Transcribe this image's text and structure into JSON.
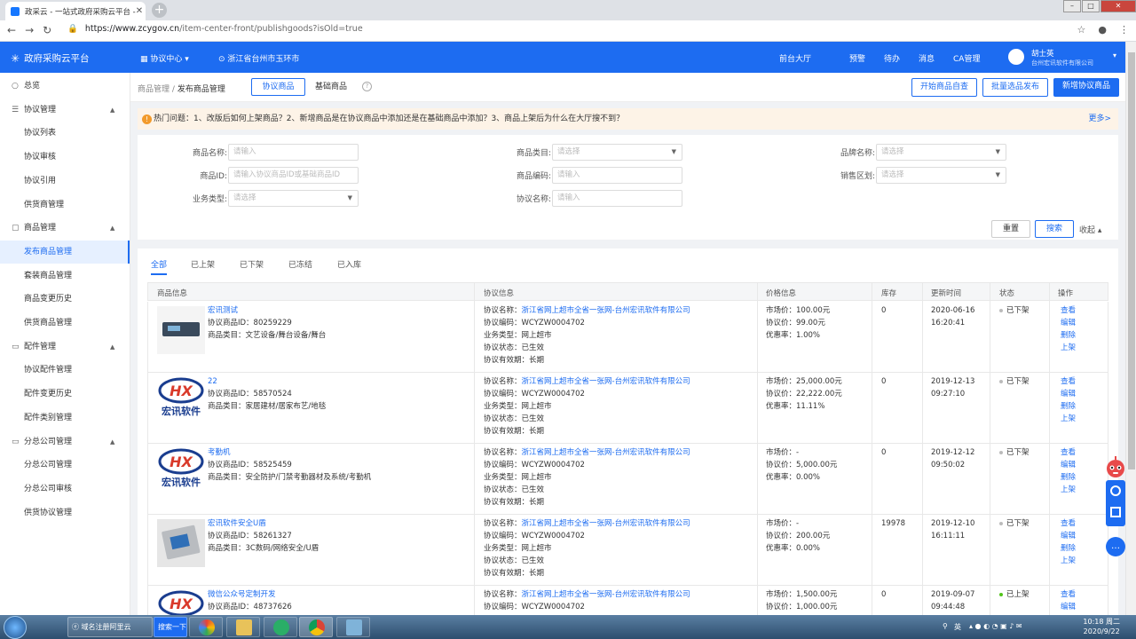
{
  "browser": {
    "tab_title": "政采云 - 一站式政府采购云平台 -",
    "url_main": "https://www.zcygov.cn",
    "url_path": "/item-center-front/publishgoods?isOld=true"
  },
  "header": {
    "logo": "政府采购云平台",
    "protocol_center": "协议中心",
    "location": "浙江省台州市玉环市",
    "nav": [
      "前台大厅",
      "预警",
      "待办",
      "消息",
      "CA管理"
    ],
    "user_name": "胡士英",
    "user_company": "台州宏讯软件有限公司"
  },
  "sidebar": {
    "items": [
      {
        "label": "总览",
        "type": "top"
      },
      {
        "label": "协议管理",
        "type": "group"
      },
      {
        "label": "协议列表",
        "type": "sub"
      },
      {
        "label": "协议审核",
        "type": "sub"
      },
      {
        "label": "协议引用",
        "type": "sub"
      },
      {
        "label": "供货商管理",
        "type": "sub"
      },
      {
        "label": "商品管理",
        "type": "group"
      },
      {
        "label": "发布商品管理",
        "type": "sub",
        "active": true
      },
      {
        "label": "套装商品管理",
        "type": "sub"
      },
      {
        "label": "商品变更历史",
        "type": "sub"
      },
      {
        "label": "供货商品管理",
        "type": "sub"
      },
      {
        "label": "配件管理",
        "type": "group"
      },
      {
        "label": "协议配件管理",
        "type": "sub"
      },
      {
        "label": "配件变更历史",
        "type": "sub"
      },
      {
        "label": "配件类别管理",
        "type": "sub"
      },
      {
        "label": "分总公司管理",
        "type": "group"
      },
      {
        "label": "分总公司管理",
        "type": "sub"
      },
      {
        "label": "分总公司审核",
        "type": "sub"
      },
      {
        "label": "供货协议管理",
        "type": "sub"
      }
    ]
  },
  "breadcrumb": {
    "parent": "商品管理",
    "sep": "/",
    "current": "发布商品管理"
  },
  "top_tabs": [
    "协议商品",
    "基础商品"
  ],
  "actions": {
    "self_check": "开始商品自查",
    "batch_publish": "批量选品发布",
    "add_new": "新增协议商品"
  },
  "notice": {
    "text": "热门问题：1、改版后如何上架商品？2、新增商品是在协议商品中添加还是在基础商品中添加？3、商品上架后为什么在大厅搜不到？",
    "more": "更多>"
  },
  "filters": {
    "name_label": "商品名称:",
    "name_ph": "请输入",
    "category_label": "商品类目:",
    "category_ph": "请选择",
    "brand_label": "品牌名称:",
    "brand_ph": "请选择",
    "id_label": "商品ID:",
    "id_ph": "请输入协议商品ID或基础商品ID",
    "code_label": "商品编码:",
    "code_ph": "请输入",
    "region_label": "销售区划:",
    "region_ph": "请选择",
    "biz_label": "业务类型:",
    "biz_ph": "请选择",
    "proto_label": "协议名称:",
    "proto_ph": "请输入",
    "reset": "重置",
    "search": "搜索",
    "collapse": "收起"
  },
  "status_tabs": [
    "全部",
    "已上架",
    "已下架",
    "已冻结",
    "已入库"
  ],
  "table": {
    "headers": [
      "商品信息",
      "协议信息",
      "价格信息",
      "库存",
      "更新时间",
      "状态",
      "操作"
    ],
    "rows": [
      {
        "name": "宏讯测试",
        "pid": "协议商品ID：80259229",
        "cat": "商品类目：文艺设备/舞台设备/舞台",
        "proto_label": "协议名称：",
        "proto_name": "浙江省网上超市全省一张网-台州宏讯软件有限公司",
        "code": "协议编码：WCYZW0004702",
        "biz": "业务类型：网上超市",
        "pstatus": "协议状态：已生效",
        "valid": "协议有效期：长期",
        "market": "市场价：100.00元",
        "agree": "协议价：99.00元",
        "disc": "优惠率：1.00%",
        "stock": "0",
        "date": "2020-06-16",
        "time": "16:20:41",
        "status": "已下架",
        "thumb": "device"
      },
      {
        "name": "22",
        "pid": "协议商品ID：58570524",
        "cat": "商品类目：家居建材/居家布艺/地毯",
        "proto_label": "协议名称：",
        "proto_name": "浙江省网上超市全省一张网-台州宏讯软件有限公司",
        "code": "协议编码：WCYZW0004702",
        "biz": "业务类型：网上超市",
        "pstatus": "协议状态：已生效",
        "valid": "协议有效期：长期",
        "market": "市场价：25,000.00元",
        "agree": "协议价：22,222.00元",
        "disc": "优惠率：11.11%",
        "stock": "0",
        "date": "2019-12-13",
        "time": "09:27:10",
        "status": "已下架",
        "thumb": "logo"
      },
      {
        "name": "考勤机",
        "pid": "协议商品ID：58525459",
        "cat": "商品类目：安全防护/门禁考勤器材及系统/考勤机",
        "proto_label": "协议名称：",
        "proto_name": "浙江省网上超市全省一张网-台州宏讯软件有限公司",
        "code": "协议编码：WCYZW0004702",
        "biz": "业务类型：网上超市",
        "pstatus": "协议状态：已生效",
        "valid": "协议有效期：长期",
        "market": "市场价：-",
        "agree": "协议价：5,000.00元",
        "disc": "优惠率：0.00%",
        "stock": "0",
        "date": "2019-12-12",
        "time": "09:50:02",
        "status": "已下架",
        "thumb": "logo"
      },
      {
        "name": "宏讯软件安全U盾",
        "pid": "协议商品ID：58261327",
        "cat": "商品类目：3C数码/网络安全/U盾",
        "proto_label": "协议名称：",
        "proto_name": "浙江省网上超市全省一张网-台州宏讯软件有限公司",
        "code": "协议编码：WCYZW0004702",
        "biz": "业务类型：网上超市",
        "pstatus": "协议状态：已生效",
        "valid": "协议有效期：长期",
        "market": "市场价：-",
        "agree": "协议价：200.00元",
        "disc": "优惠率：0.00%",
        "stock": "19978",
        "date": "2019-12-10",
        "time": "16:11:11",
        "status": "已下架",
        "thumb": "ukey"
      },
      {
        "name": "微信公众号定制开发",
        "pid": "协议商品ID：48737626",
        "cat": "",
        "proto_label": "协议名称：",
        "proto_name": "浙江省网上超市全省一张网-台州宏讯软件有限公司",
        "code": "协议编码：WCYZW0004702",
        "biz": "",
        "pstatus": "",
        "valid": "",
        "market": "市场价：1,500.00元",
        "agree": "协议价：1,000.00元",
        "disc": "",
        "stock": "0",
        "date": "2019-09-07",
        "time": "09:44:48",
        "status": "已上架",
        "thumb": "logo"
      }
    ],
    "ops": [
      "查看",
      "编辑",
      "删除",
      "上架"
    ],
    "ops_online": [
      "查看",
      "编辑"
    ]
  },
  "taskbar": {
    "ie_label": "域名注册阿里云",
    "search_label": "搜索一下",
    "ime": "英",
    "time": "10:18 周二",
    "date": "2020/9/22"
  }
}
